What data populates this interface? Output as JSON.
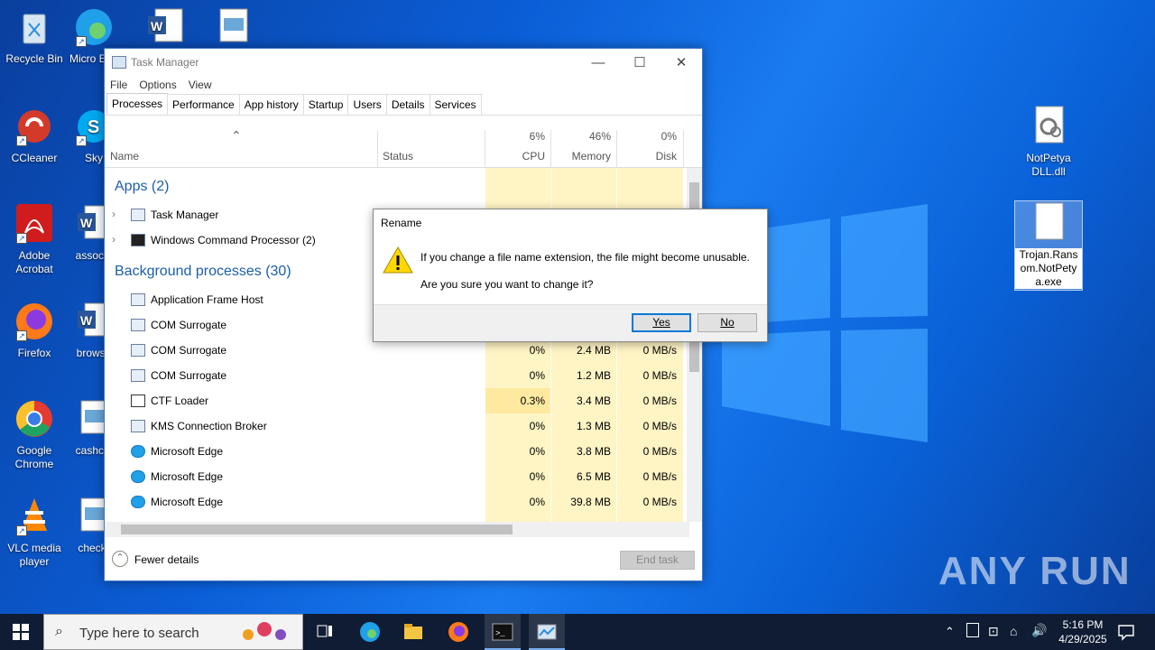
{
  "desktop": {
    "icons": [
      {
        "label": "Recycle Bin"
      },
      {
        "label": "Micro Edg"
      },
      {
        "label": "CCleaner"
      },
      {
        "label": "Sky"
      },
      {
        "label": "Adobe Acrobat"
      },
      {
        "label": "associa"
      },
      {
        "label": "Firefox"
      },
      {
        "label": "browse"
      },
      {
        "label": "Google Chrome"
      },
      {
        "label": "cashcla"
      },
      {
        "label": "VLC media player"
      },
      {
        "label": "checkr"
      },
      {
        "label": "NotPetya DLL.dll"
      },
      {
        "label": "Trojan.Ransom.NotPetya.exe"
      }
    ]
  },
  "taskmanager": {
    "title": "Task Manager",
    "menu": [
      "File",
      "Options",
      "View"
    ],
    "tabs": [
      "Processes",
      "Performance",
      "App history",
      "Startup",
      "Users",
      "Details",
      "Services"
    ],
    "active_tab": "Processes",
    "columns": {
      "name": "Name",
      "status": "Status",
      "cpu_pct": "6%",
      "cpu": "CPU",
      "mem_pct": "46%",
      "mem": "Memory",
      "disk_pct": "0%",
      "disk": "Disk"
    },
    "groups": {
      "apps": "Apps (2)",
      "background": "Background processes (30)"
    },
    "apps": [
      {
        "name": "Task Manager"
      },
      {
        "name": "Windows Command Processor (2)"
      }
    ],
    "background": [
      {
        "name": "Application Frame Host",
        "cpu": "",
        "mem": "",
        "disk": ""
      },
      {
        "name": "COM Surrogate",
        "cpu": "",
        "mem": "",
        "disk": ""
      },
      {
        "name": "COM Surrogate",
        "cpu": "0%",
        "mem": "2.4 MB",
        "disk": "0 MB/s"
      },
      {
        "name": "COM Surrogate",
        "cpu": "0%",
        "mem": "1.2 MB",
        "disk": "0 MB/s"
      },
      {
        "name": "CTF Loader",
        "cpu": "0.3%",
        "mem": "3.4 MB",
        "disk": "0 MB/s"
      },
      {
        "name": "KMS Connection Broker",
        "cpu": "0%",
        "mem": "1.3 MB",
        "disk": "0 MB/s"
      },
      {
        "name": "Microsoft Edge",
        "cpu": "0%",
        "mem": "3.8 MB",
        "disk": "0 MB/s"
      },
      {
        "name": "Microsoft Edge",
        "cpu": "0%",
        "mem": "6.5 MB",
        "disk": "0 MB/s"
      },
      {
        "name": "Microsoft Edge",
        "cpu": "0%",
        "mem": "39.8 MB",
        "disk": "0 MB/s"
      }
    ],
    "fewer_details": "Fewer details",
    "end_task": "End task"
  },
  "dialog": {
    "title": "Rename",
    "line1": "If you change a file name extension, the file might become unusable.",
    "line2": "Are you sure you want to change it?",
    "yes": "Yes",
    "no": "No"
  },
  "taskbar": {
    "search_placeholder": "Type here to search",
    "time": "5:16 PM",
    "date": "4/29/2025"
  },
  "watermark": "ANY RUN"
}
